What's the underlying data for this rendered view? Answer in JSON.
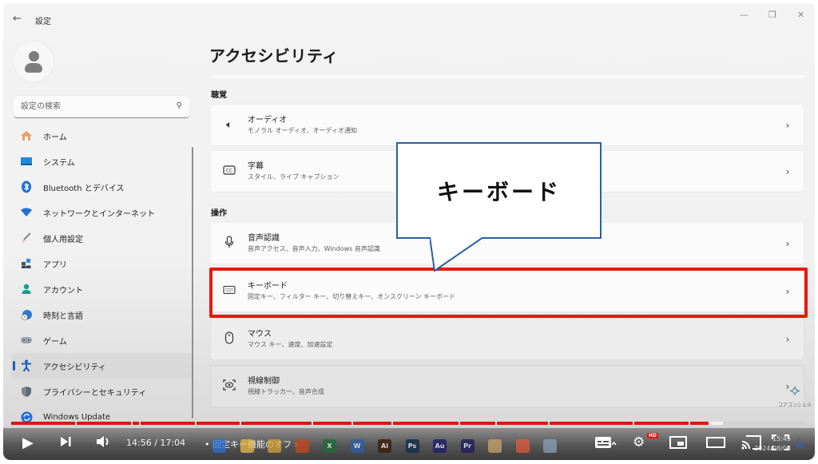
{
  "window": {
    "back_label": "←",
    "title": "設定",
    "controls": {
      "minimize": "—",
      "maximize": "❐",
      "close": "✕"
    }
  },
  "search": {
    "placeholder": "設定の検索",
    "icon": "search-icon"
  },
  "sidebar": {
    "items": [
      {
        "label": "ホーム",
        "icon": "home-icon",
        "active": false
      },
      {
        "label": "システム",
        "icon": "system-display-icon",
        "active": false
      },
      {
        "label": "Bluetooth とデバイス",
        "icon": "bluetooth-icon",
        "active": false
      },
      {
        "label": "ネットワークとインターネット",
        "icon": "wifi-icon",
        "active": false
      },
      {
        "label": "個人用設定",
        "icon": "paintbrush-icon",
        "active": false
      },
      {
        "label": "アプリ",
        "icon": "apps-icon",
        "active": false
      },
      {
        "label": "アカウント",
        "icon": "account-icon",
        "active": false
      },
      {
        "label": "時刻と言語",
        "icon": "time-language-icon",
        "active": false
      },
      {
        "label": "ゲーム",
        "icon": "gamepad-icon",
        "active": false
      },
      {
        "label": "アクセシビリティ",
        "icon": "accessibility-icon",
        "active": true
      },
      {
        "label": "プライバシーとセキュリティ",
        "icon": "shield-icon",
        "active": false
      },
      {
        "label": "Windows Update",
        "icon": "windows-update-icon",
        "active": false
      }
    ]
  },
  "main": {
    "title": "アクセシビリティ",
    "sections": [
      {
        "label": "聴覚",
        "cards": [
          {
            "title": "オーディオ",
            "subtitle": "モノラル オーディオ、オーディオ通知",
            "icon": "speaker-icon"
          },
          {
            "title": "字幕",
            "subtitle": "スタイル、ライブ キャプション",
            "icon": "closed-caption-icon"
          }
        ]
      },
      {
        "label": "操作",
        "cards": [
          {
            "title": "音声認識",
            "subtitle": "音声アクセス、音声入力、Windows 音声認識",
            "icon": "microphone-icon"
          },
          {
            "title": "キーボード",
            "subtitle": "固定キー、フィルター キー、切り替えキー、オンスクリーン キーボード",
            "icon": "keyboard-icon",
            "highlighted": true
          },
          {
            "title": "マウス",
            "subtitle": "マウス キー、速度、加速設定",
            "icon": "mouse-icon"
          },
          {
            "title": "視線制御",
            "subtitle": "視線トラッカー、音声合成",
            "icon": "eye-control-icon"
          }
        ]
      }
    ],
    "chevron": "›"
  },
  "annotation": {
    "callout_text": "キーボード",
    "callout_border_color": "#2b5fa8",
    "highlight_color": "#e8190f"
  },
  "watermark": {
    "text": "コアコンシェル"
  },
  "video_player": {
    "current_time": "14:56",
    "duration": "17:04",
    "time_display": "14:56 / 17:04",
    "chapter": "• 固定キー機能のオフ ›",
    "progress_fraction": 0.877,
    "buffered_fraction": 0.895,
    "played_color": "#e3140b",
    "hd_badge": "HD",
    "buttons": {
      "play": "▶",
      "next": "⏭",
      "volume": "🔊",
      "subtitles": "subtitles-icon",
      "settings": "gear-icon",
      "miniplayer": "miniplayer-icon",
      "theater": "theater-mode-icon",
      "cast": "cast-icon",
      "fullscreen": "fullscreen-icon"
    }
  },
  "taskbar_overlay": {
    "clock_time": "15:45",
    "clock_date": "2024/08/08",
    "apps": [
      {
        "label": "",
        "icon": "windows-start-icon",
        "color": "#2b6fd1"
      },
      {
        "label": "",
        "icon": "file-explorer-icon",
        "color": "#e9b949"
      },
      {
        "label": "",
        "icon": "chrome-icon",
        "color": "#d7a13a"
      },
      {
        "label": "",
        "icon": "powerpoint-icon",
        "color": "#c8461e"
      },
      {
        "label": "X",
        "icon": "excel-icon",
        "color": "#1d6b3a"
      },
      {
        "label": "W",
        "icon": "word-icon",
        "color": "#2a5faa"
      },
      {
        "label": "Ai",
        "icon": "illustrator-icon",
        "color": "#3a1a07"
      },
      {
        "label": "Ps",
        "icon": "photoshop-icon",
        "color": "#0b2c4d"
      },
      {
        "label": "Au",
        "icon": "audition-icon",
        "color": "#1b1b6b"
      },
      {
        "label": "Pr",
        "icon": "premiere-icon",
        "color": "#1d1a5a"
      },
      {
        "label": "",
        "icon": "snipping-tool-icon",
        "color": "#c9a36b"
      },
      {
        "label": "",
        "icon": "paint-drop-icon",
        "color": "#e05a3a"
      },
      {
        "label": "",
        "icon": "settings-gear-icon",
        "color": "#8aa0b8"
      }
    ]
  }
}
